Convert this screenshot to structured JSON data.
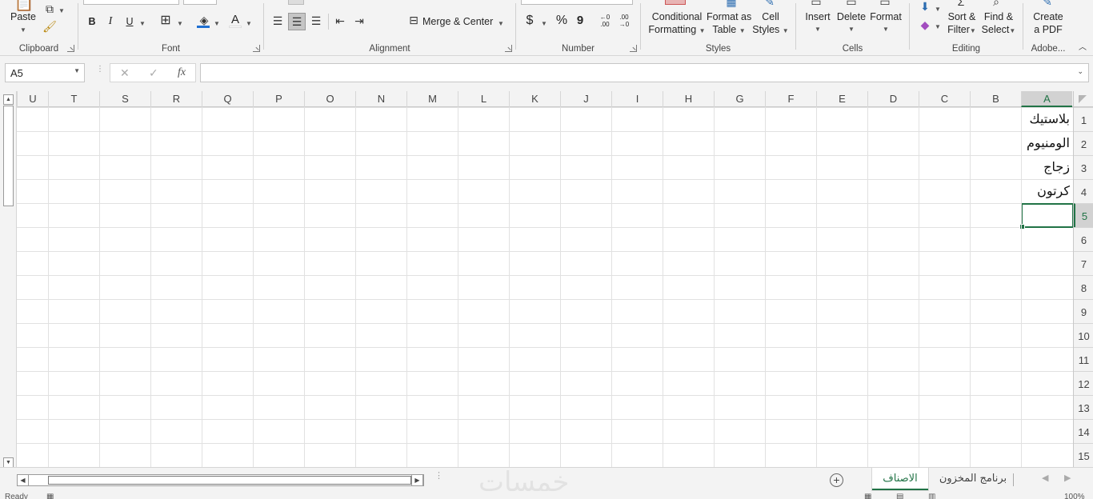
{
  "ribbon": {
    "clipboard": {
      "label": "Clipboard",
      "paste": "Paste"
    },
    "font": {
      "label": "Font",
      "bold": "B",
      "italic": "I",
      "underline": "U",
      "font_color": "A"
    },
    "alignment": {
      "label": "Alignment",
      "merge_center": "Merge & Center"
    },
    "number": {
      "label": "Number",
      "currency": "$",
      "percent": "%",
      "comma": "9",
      "inc_decimal": "←0 .00",
      "dec_decimal": ".00 →0"
    },
    "styles": {
      "label": "Styles",
      "conditional_formatting": [
        "Conditional",
        "Formatting"
      ],
      "format_as_table": [
        "Format as",
        "Table"
      ],
      "cell_styles": [
        "Cell",
        "Styles"
      ]
    },
    "cells": {
      "label": "Cells",
      "insert": "Insert",
      "delete": "Delete",
      "format": "Format"
    },
    "editing": {
      "label": "Editing",
      "sort_filter": [
        "Sort &",
        "Filter"
      ],
      "find_select": [
        "Find &",
        "Select"
      ]
    },
    "adobe": {
      "label": "Adobe...",
      "create_pdf": [
        "Create",
        "a PDF"
      ]
    }
  },
  "formula_bar": {
    "name_box": "A5",
    "cancel": "✕",
    "enter": "✓",
    "fx": "fx",
    "value": ""
  },
  "columns": [
    "U",
    "T",
    "S",
    "R",
    "Q",
    "P",
    "O",
    "N",
    "M",
    "L",
    "K",
    "J",
    "I",
    "H",
    "G",
    "F",
    "E",
    "D",
    "C",
    "B",
    "A"
  ],
  "rows": [
    "1",
    "2",
    "3",
    "4",
    "5",
    "6",
    "7",
    "8",
    "9",
    "10",
    "11",
    "12",
    "13",
    "14",
    "15"
  ],
  "cells": {
    "A1": "بلاستيك",
    "A2": "الومنيوم",
    "A3": "زجاج",
    "A4": "كرتون"
  },
  "active_cell": "A5",
  "sheets": [
    {
      "name": "الاصناف",
      "active": true
    },
    {
      "name": "برنامج المخزون",
      "active": false
    }
  ],
  "watermark": "خمسات",
  "status": {
    "ready": "Ready",
    "zoom": "100%"
  }
}
